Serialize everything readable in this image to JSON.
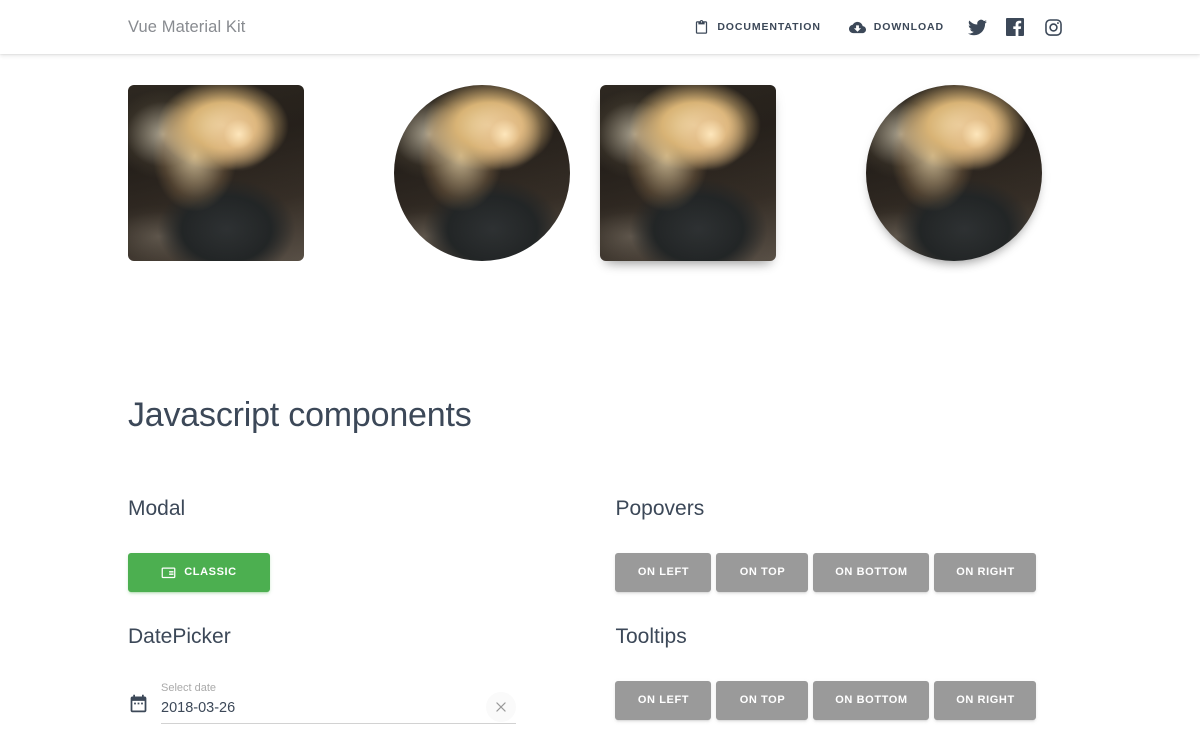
{
  "navbar": {
    "brand": "Vue Material Kit",
    "links": [
      {
        "label": "DOCUMENTATION",
        "icon": "clipboard-icon"
      },
      {
        "label": "DOWNLOAD",
        "icon": "cloud-download-icon"
      }
    ],
    "social": [
      {
        "name": "twitter-icon"
      },
      {
        "name": "facebook-icon"
      },
      {
        "name": "instagram-icon"
      }
    ]
  },
  "images": [
    {
      "name": "image-rounded",
      "style": "rounded"
    },
    {
      "name": "image-circle",
      "style": "circle"
    },
    {
      "name": "image-rounded-raised",
      "style": "rounded raised"
    },
    {
      "name": "image-circle-raised",
      "style": "circle raised"
    }
  ],
  "main": {
    "title": "Javascript components",
    "modal": {
      "heading": "Modal",
      "button": {
        "label": "CLASSIC",
        "icon": "reader-mode-icon",
        "color": "#4caf50"
      }
    },
    "datepicker": {
      "heading": "DatePicker",
      "label": "Select date",
      "value": "2018-03-26",
      "calendar_icon": "calendar-icon",
      "clear_icon": "close-icon"
    },
    "popovers": {
      "heading": "Popovers",
      "buttons": [
        "ON LEFT",
        "ON TOP",
        "ON BOTTOM",
        "ON RIGHT"
      ]
    },
    "tooltips": {
      "heading": "Tooltips",
      "buttons": [
        "ON LEFT",
        "ON TOP",
        "ON BOTTOM",
        "ON RIGHT"
      ]
    }
  },
  "colors": {
    "accent_green": "#4caf50",
    "gray_button": "#9a9a9a",
    "text_dark": "#3c4858"
  }
}
